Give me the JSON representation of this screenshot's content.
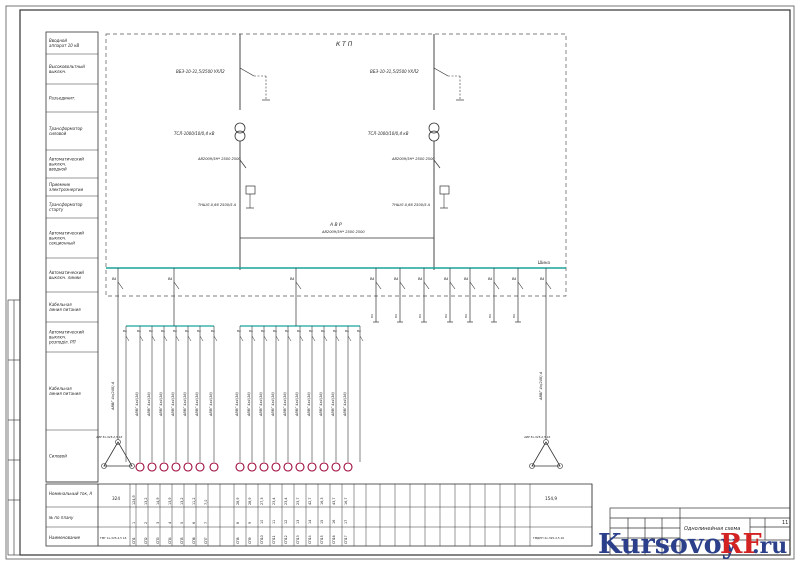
{
  "sheet": {
    "row_labels": [
      "Вводной аппарат 10 кВ",
      "Высоковольтный выключ.",
      "Разъединит.",
      "Трансформатор силовой",
      "Автоматический выключ. вводной",
      "Приемник электроэнергии",
      "Трансформатор старту",
      "Автоматический выключ. секционный",
      "Автоматический выключ. линии",
      "Кабельная линия питания",
      "Автоматический выключ. розподіл. РП",
      "Кабельная линия питания",
      "Силовой"
    ],
    "bottom_labels": [
      "Номинальный ток, А",
      "№ по плану",
      "Наименование"
    ],
    "title_box": "К Т П",
    "busbar_label": "Шина",
    "sectional_label": "А В Р",
    "sectional_breaker": "АВ2009/3Н* 2500 2500",
    "left_input": {
      "breaker": "ВБЭ-10-31,5/2500 УХЛ2",
      "transformer": "ТСЛ-1000/10/0,4 кВ",
      "auto": "АВ2009/3Н* 2500 2500",
      "ct": "ТНШЛ-0,66 2500/5 А"
    },
    "right_input": {
      "breaker": "ВБЭ-10-31,5/2500 УХЛ2",
      "transformer": "ТСЛ-1000/10/0,4 кВ",
      "auto": "АВ2009/3Н* 2500 2500",
      "ct": "ТНШЛ-0,66 2500/5 А"
    },
    "feeder_tag": "ВА",
    "cable_left": [
      "АВВГ 4х4(16)",
      "АВВГ 4х4(16)",
      "АВВГ 4х4(16)",
      "АВВГ 4х4(16)",
      "АВВГ 4х4(16)",
      "АВВГ 4х4(16)",
      "АВВГ 4х4(16)"
    ],
    "cable_mid": [
      "АВВГ 4х4(16)",
      "АВВГ 4х4(16)",
      "АВВГ 4х4(16)",
      "АВВГ 4х4(16)",
      "АВВГ 4х4(16)",
      "АВВГ 4х4(16)",
      "АВВГ 4х4(16)",
      "АВВГ 4х4(16)",
      "АВВГ 4х4(16)",
      "АВВГ 4х4(16)"
    ],
    "cable_main_left": "АВВГ 4х(240) А",
    "cable_main_right": "АВВГ 4х(240) А",
    "current_values": {
      "first": "324",
      "left": [
        "124,9",
        "13,2",
        "14,9",
        "13,9",
        "13,2",
        "11,2",
        "7,0"
      ],
      "mid": [
        "28,9",
        "28,9",
        "27,3",
        "23,4",
        "23,4",
        "23,7",
        "42,7",
        "16,3",
        "43,7",
        "16,7"
      ],
      "right": "154,9"
    },
    "plan_numbers": {
      "left": [
        "1",
        "2",
        "3",
        "4",
        "5",
        "6",
        "7"
      ],
      "mid": [
        "8",
        "9",
        "10",
        "11",
        "12",
        "13",
        "14",
        "15",
        "16",
        "17"
      ]
    },
    "names": {
      "first": "ТМГ 1х-325-2,5 16",
      "left": [
        "СП1",
        "СП2",
        "СП3",
        "СП4",
        "СП5",
        "СП6",
        "СП7"
      ],
      "mid": [
        "СП8",
        "СП9",
        "СП10",
        "СП11",
        "СП12",
        "СП13",
        "СП14",
        "СП15",
        "СП16",
        "СП17"
      ],
      "right": "ТМДНН 4х-325-2,5 16"
    },
    "motor_label": "АИР 5х-325-2,5 16",
    "stamp": {
      "sheet_no": "11",
      "doc_title": "Однолинейная схема"
    },
    "watermark": {
      "main": "Kursovoy",
      "accent": "RF",
      "suffix": ".ru"
    },
    "colors": {
      "line": "#333333",
      "bus": "#1aa39a",
      "accent": "#d22222",
      "watermark": "#2b3f8a"
    }
  }
}
